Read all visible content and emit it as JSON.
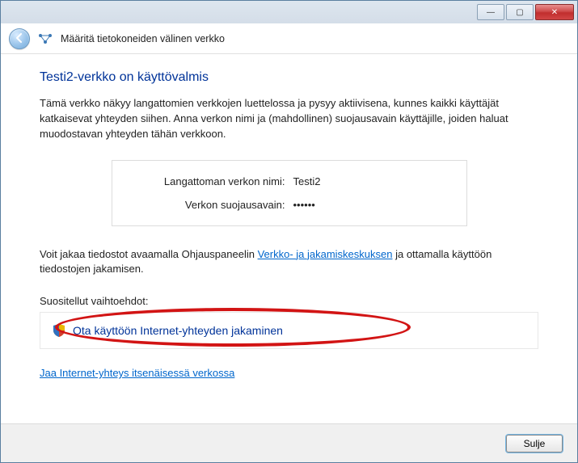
{
  "titlebar": {
    "minimize": "—",
    "maximize": "▢",
    "close": "✕"
  },
  "header": {
    "title": "Määritä tietokoneiden välinen verkko"
  },
  "main": {
    "heading": "Testi2-verkko on käyttövalmis",
    "paragraph": "Tämä verkko näkyy langattomien verkkojen luettelossa ja pysyy aktiivisena, kunnes kaikki käyttäjät katkaisevat yhteyden siihen. Anna verkon nimi ja (mahdollinen) suojausavain käyttäjille, joiden haluat muodostavan yhteyden tähän verkkoon.",
    "info": {
      "name_label": "Langattoman verkon nimi:",
      "name_value": "Testi2",
      "key_label": "Verkon suojausavain:",
      "key_value": "••••••"
    },
    "share_text_pre": "Voit jakaa tiedostot avaamalla Ohjauspaneelin ",
    "share_link": "Verkko- ja jakamiskeskuksen",
    "share_text_post": " ja ottamalla käyttöön tiedostojen jakamisen.",
    "recommended_label": "Suositellut vaihtoehdot:",
    "option_text": "Ota käyttöön Internet-yhteyden jakaminen",
    "bottom_link": "Jaa Internet-yhteys itsenäisessä verkossa"
  },
  "footer": {
    "close_label": "Sulje"
  }
}
